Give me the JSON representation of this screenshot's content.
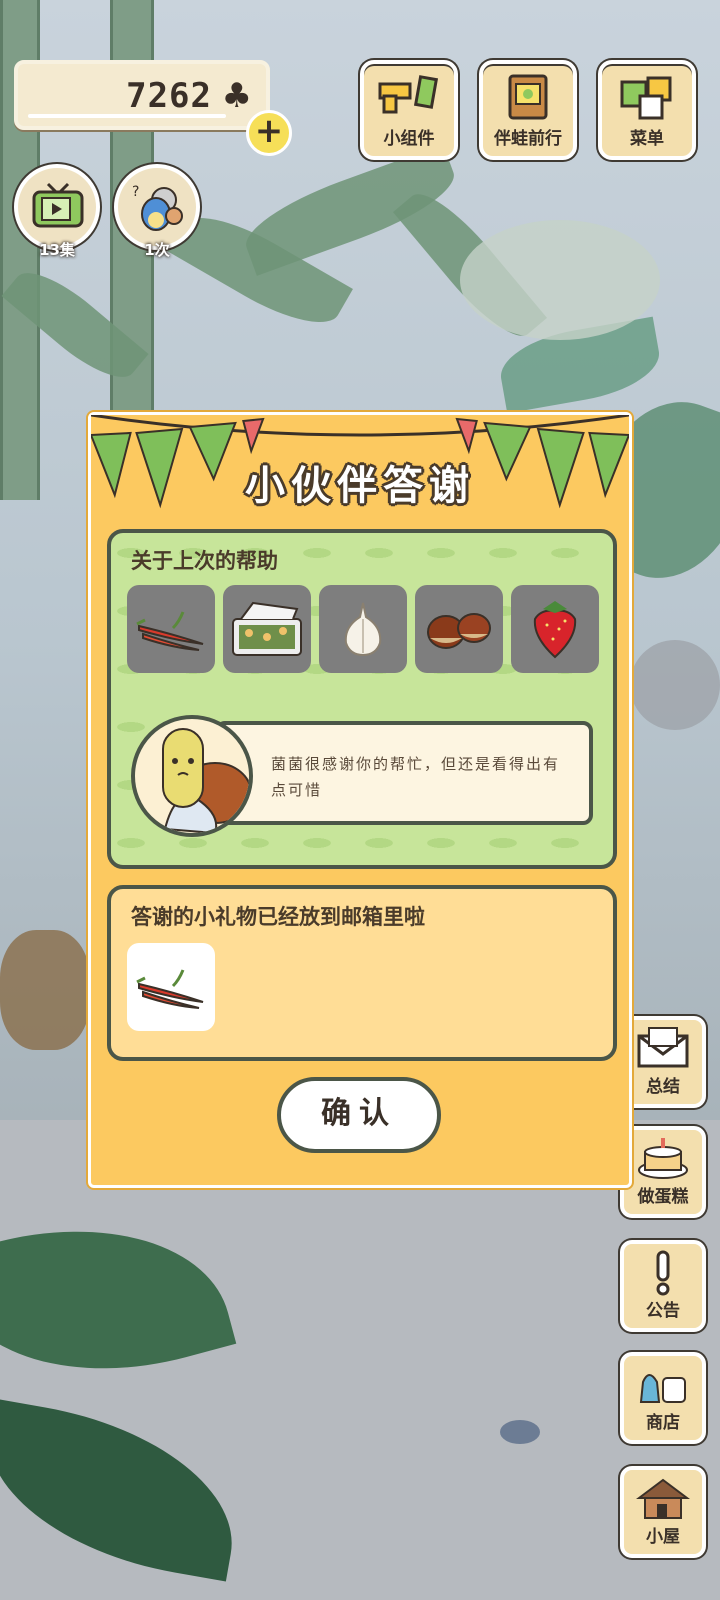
{
  "header": {
    "clover_count": "7262",
    "clover_icon": "clover-icon",
    "add_label": "+"
  },
  "top_buttons": [
    {
      "label": "小组件",
      "icon": "widget-icon"
    },
    {
      "label": "伴蛙前行",
      "icon": "album-icon"
    },
    {
      "label": "菜单",
      "icon": "menu-icon"
    }
  ],
  "round_buttons": [
    {
      "count": "13集",
      "icon": "tv-icon"
    },
    {
      "count": "1次",
      "icon": "visitors-icon"
    }
  ],
  "side_buttons": [
    {
      "label": "总结",
      "icon": "letter-icon"
    },
    {
      "label": "做蛋糕",
      "icon": "cake-icon"
    },
    {
      "label": "公告",
      "icon": "exclamation-icon"
    },
    {
      "label": "商店",
      "icon": "shop-icon"
    },
    {
      "label": "小屋",
      "icon": "house-icon"
    }
  ],
  "dialog": {
    "title": "小伙伴答谢",
    "help_heading": "关于上次的帮助",
    "items": [
      "chili-icon",
      "bento-icon",
      "garlic-icon",
      "chestnut-icon",
      "strawberry-icon"
    ],
    "message": "菌菌很感谢你的帮忙，但还是看得出有点可惜",
    "gift_heading": "答谢的小礼物已经放到邮箱里啦",
    "gift_item": "chili-icon",
    "confirm_label": "确认"
  },
  "colors": {
    "dialog_bg": "#fcc960",
    "help_bg": "#c7e59a",
    "gift_bg": "#ffdd96",
    "outline": "#4b5648"
  }
}
